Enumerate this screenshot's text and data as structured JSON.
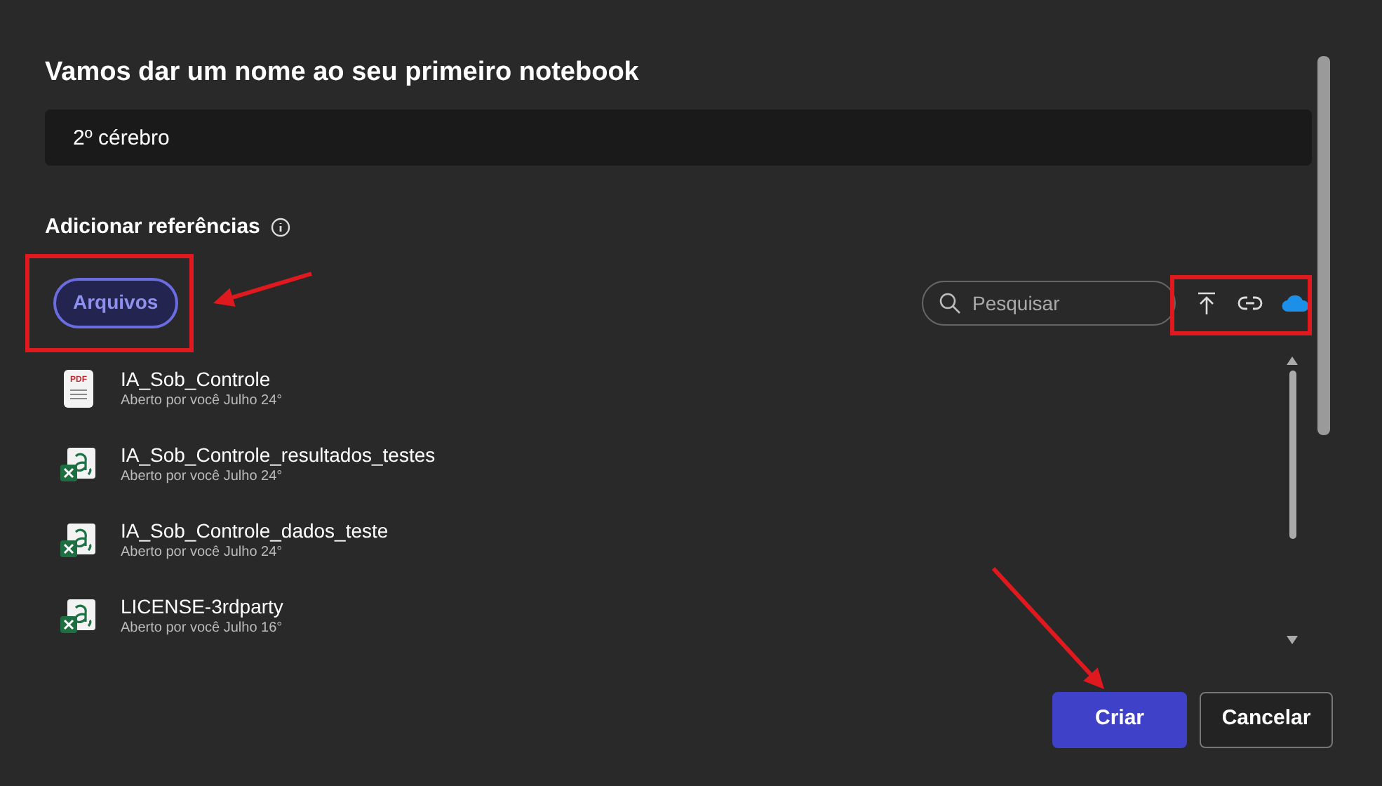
{
  "dialog": {
    "title": "Vamos dar um nome ao seu primeiro notebook",
    "name_field": {
      "value": "2º cérebro"
    }
  },
  "references": {
    "label": "Adicionar referências",
    "tabs": [
      {
        "label": "Arquivos",
        "selected": true
      }
    ],
    "search": {
      "placeholder": "Pesquisar"
    },
    "files": [
      {
        "kind": "pdf",
        "icon_text": "PDF",
        "name": "IA_Sob_Controle",
        "meta": "Aberto por você Julho 24°"
      },
      {
        "kind": "excel",
        "name": "IA_Sob_Controle_resultados_testes",
        "meta": "Aberto por você Julho 24°"
      },
      {
        "kind": "excel",
        "name": "IA_Sob_Controle_dados_teste",
        "meta": "Aberto por você Julho 24°"
      },
      {
        "kind": "excel",
        "name": "LICENSE-3rdparty",
        "meta": "Aberto por você Julho 16°"
      }
    ]
  },
  "buttons": [
    {
      "kind": "primary",
      "label": "Criar"
    },
    {
      "kind": "secondary",
      "label": "Cancelar"
    }
  ]
}
